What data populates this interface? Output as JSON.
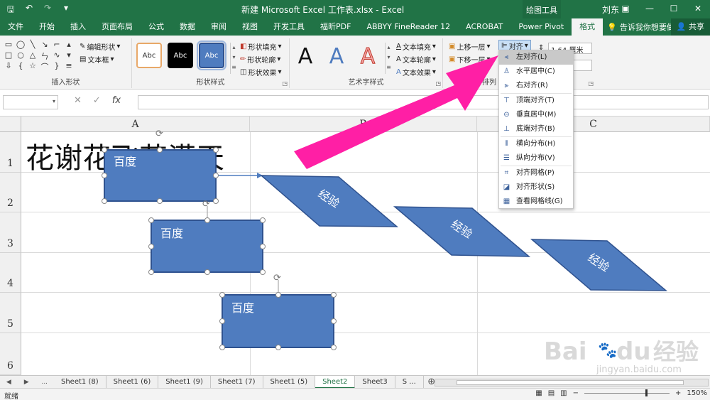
{
  "titlebar": {
    "title": "新建 Microsoft Excel 工作表.xlsx - Excel",
    "context_tool": "绘图工具",
    "user": "刘东",
    "qat": [
      "save-icon",
      "undo-icon",
      "redo-icon",
      "customize-icon"
    ]
  },
  "tabs": [
    {
      "label": "文件"
    },
    {
      "label": "开始"
    },
    {
      "label": "插入"
    },
    {
      "label": "页面布局"
    },
    {
      "label": "公式"
    },
    {
      "label": "数据"
    },
    {
      "label": "审阅"
    },
    {
      "label": "视图"
    },
    {
      "label": "开发工具"
    },
    {
      "label": "福昕PDF"
    },
    {
      "label": "ABBYY FineReader 12"
    },
    {
      "label": "ACROBAT"
    },
    {
      "label": "Power Pivot"
    },
    {
      "label": "格式"
    }
  ],
  "active_tab": "格式",
  "tell_me": "告诉我你想要做什么",
  "share": "共享",
  "ribbon": {
    "insert_shapes": {
      "edit_shape": "编辑形状",
      "text_box": "文本框",
      "label": "插入形状"
    },
    "shape_styles": {
      "samples": [
        "Abc",
        "Abc",
        "Abc"
      ],
      "fill": "形状填充",
      "outline": "形状轮廓",
      "effects": "形状效果",
      "label": "形状样式"
    },
    "wordart_styles": {
      "samples": [
        "A",
        "A",
        "A"
      ],
      "text_fill": "文本填充",
      "text_outline": "文本轮廓",
      "text_effects": "文本效果",
      "label": "艺术字样式"
    },
    "arrange": {
      "bring_forward": "上移一层",
      "send_backward": "下移一层",
      "align": "对齐",
      "label": "排列"
    },
    "size": {
      "height": "1.64 厘米"
    }
  },
  "formula_bar": {
    "cancel": "✕",
    "enter": "✓",
    "fx": "fx",
    "name_box": "",
    "formula": ""
  },
  "grid": {
    "columns": [
      "A",
      "B",
      "C"
    ],
    "rows": [
      "1",
      "2",
      "3",
      "4",
      "5",
      "6"
    ],
    "cell_a1": "花谢花飞花满天"
  },
  "shapes": {
    "rect_text": "百度",
    "parallelogram_text": "经验"
  },
  "align_menu": [
    {
      "label": "左对齐(L)",
      "icon": "align-left-icon"
    },
    {
      "label": "水平居中(C)",
      "icon": "align-center-icon"
    },
    {
      "label": "右对齐(R)",
      "icon": "align-right-icon"
    },
    {
      "label": "顶端对齐(T)",
      "icon": "align-top-icon"
    },
    {
      "label": "垂直居中(M)",
      "icon": "align-middle-icon"
    },
    {
      "label": "底端对齐(B)",
      "icon": "align-bottom-icon"
    },
    {
      "label": "横向分布(H)",
      "icon": "distribute-horizontal-icon"
    },
    {
      "label": "纵向分布(V)",
      "icon": "distribute-vertical-icon"
    },
    {
      "label": "对齐网格(P)",
      "icon": "snap-grid-icon"
    },
    {
      "label": "对齐形状(S)",
      "icon": "snap-shape-icon"
    },
    {
      "label": "查看网格线(G)",
      "icon": "view-gridlines-icon"
    }
  ],
  "sheets": [
    {
      "label": "Sheet1 (8)"
    },
    {
      "label": "Sheet1 (6)"
    },
    {
      "label": "Sheet1 (9)"
    },
    {
      "label": "Sheet1 (7)"
    },
    {
      "label": "Sheet1 (5)"
    },
    {
      "label": "Sheet2"
    },
    {
      "label": "Sheet3"
    },
    {
      "label": "S ..."
    }
  ],
  "active_sheet": "Sheet2",
  "sheet_nav_more": "...",
  "status": {
    "ready": "就绪",
    "zoom": "150%"
  },
  "watermark": {
    "brand": "Bai",
    "brand2": "du",
    "cn": "经验",
    "url": "jingyan.baidu.com"
  },
  "colors": {
    "excel_green": "#217346",
    "shape_fill": "#4f7cbf",
    "shape_stroke": "#2f528f",
    "arrow_magenta": "#ff1fa5",
    "menu_highlight": "#c9c9c9"
  }
}
